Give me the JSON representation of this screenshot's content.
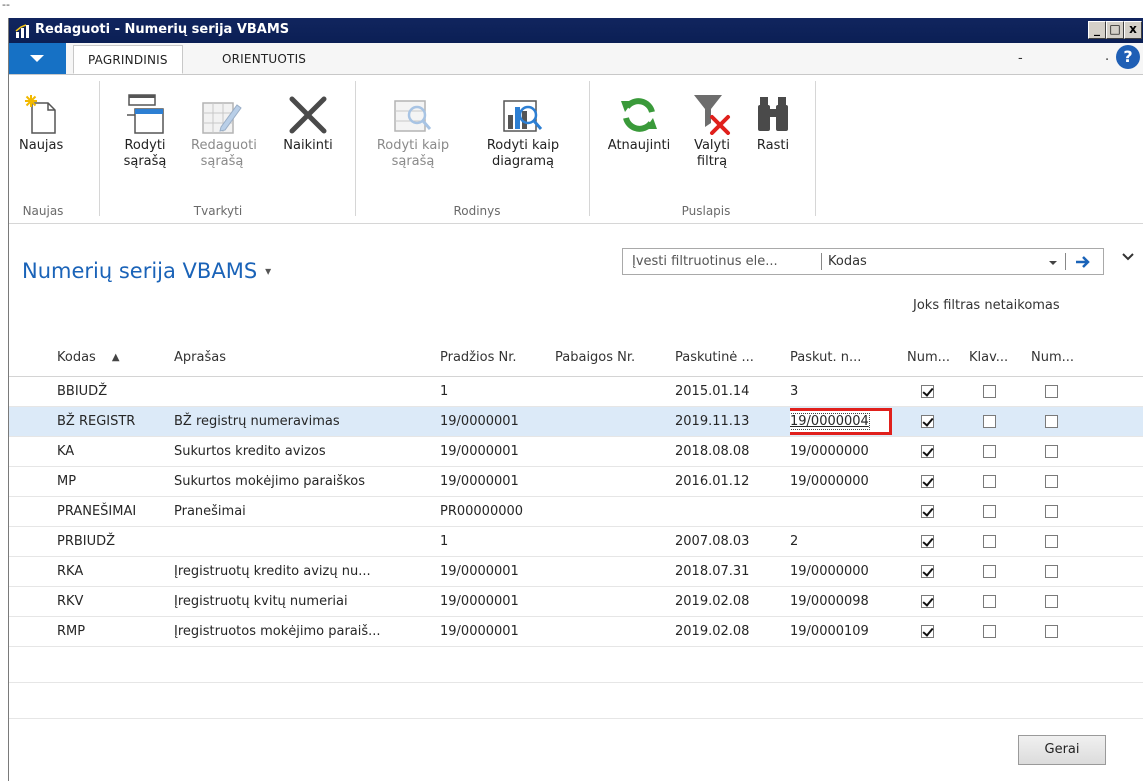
{
  "window": {
    "title": "Redaguoti - Numerių serija VBAMS",
    "controls": {
      "minimize": "_",
      "maximize": "□",
      "close": "x"
    }
  },
  "tabs": {
    "items": [
      {
        "label": "PAGRINDINIS"
      },
      {
        "label": "ORIENTUOTIS"
      }
    ],
    "right_minus": "-",
    "right_dot": ".",
    "help": "?"
  },
  "ribbon": {
    "groups": [
      {
        "label": "Naujas",
        "buttons": [
          {
            "label_line1": "Naujas",
            "label_line2": "",
            "icon": "new-document-icon"
          }
        ]
      },
      {
        "label": "Tvarkyti",
        "buttons": [
          {
            "label_line1": "Rodyti",
            "label_line2": "sąrašą",
            "icon": "show-list-icon"
          },
          {
            "label_line1": "Redaguoti",
            "label_line2": "sąrašą",
            "icon": "edit-list-icon",
            "disabled": true
          },
          {
            "label_line1": "Naikinti",
            "label_line2": "",
            "icon": "delete-icon"
          }
        ]
      },
      {
        "label": "Rodinys",
        "buttons": [
          {
            "label_line1": "Rodyti kaip",
            "label_line2": "sąrašą",
            "icon": "view-list-icon",
            "disabled": true
          },
          {
            "label_line1": "Rodyti kaip",
            "label_line2": "diagramą",
            "icon": "view-chart-icon"
          }
        ]
      },
      {
        "label": "Puslapis",
        "buttons": [
          {
            "label_line1": "Atnaujinti",
            "label_line2": "",
            "icon": "refresh-icon"
          },
          {
            "label_line1": "Valyti",
            "label_line2": "filtrą",
            "icon": "clear-filter-icon"
          },
          {
            "label_line1": "Rasti",
            "label_line2": "",
            "icon": "find-icon"
          }
        ]
      }
    ]
  },
  "page": {
    "title": "Numerių serija VBAMS",
    "title_caret": "▾",
    "filter": {
      "placeholder": "Įvesti filtruotinus ele...",
      "field": "Kodas"
    },
    "no_filter": "Joks filtras netaikomas"
  },
  "grid": {
    "columns": [
      "Kodas",
      "Aprašas",
      "Pradžios Nr.",
      "Pabaigos Nr.",
      "Paskutinė ...",
      "Paskut. n...",
      "Num...",
      "Klav...",
      "Num..."
    ],
    "sort_indicator": "▲",
    "rows": [
      {
        "kodas": "BBIUDŽ",
        "aprasas": "",
        "pradzios": "1",
        "pabaigos": "",
        "paskutine": "2015.01.14",
        "paskut_n": "3",
        "c1": true,
        "c2": false,
        "c3": false
      },
      {
        "kodas": "BŽ REGISTR",
        "aprasas": "BŽ registrų numeravimas",
        "pradzios": "19/0000001",
        "pabaigos": "",
        "paskutine": "2019.11.13",
        "paskut_n": "19/0000004",
        "c1": true,
        "c2": false,
        "c3": false,
        "selected": true
      },
      {
        "kodas": "KA",
        "aprasas": "Sukurtos kredito avizos",
        "pradzios": "19/0000001",
        "pabaigos": "",
        "paskutine": "2018.08.08",
        "paskut_n": "19/0000000",
        "c1": true,
        "c2": false,
        "c3": false
      },
      {
        "kodas": "MP",
        "aprasas": "Sukurtos mokėjimo paraiškos",
        "pradzios": "19/0000001",
        "pabaigos": "",
        "paskutine": "2016.01.12",
        "paskut_n": "19/0000000",
        "c1": true,
        "c2": false,
        "c3": false
      },
      {
        "kodas": "PRANEŠIMAI",
        "aprasas": "Pranešimai",
        "pradzios": "PR00000000",
        "pabaigos": "",
        "paskutine": "",
        "paskut_n": "",
        "c1": true,
        "c2": false,
        "c3": false
      },
      {
        "kodas": "PRBIUDŽ",
        "aprasas": "",
        "pradzios": "1",
        "pabaigos": "",
        "paskutine": "2007.08.03",
        "paskut_n": "2",
        "c1": true,
        "c2": false,
        "c3": false
      },
      {
        "kodas": "RKA",
        "aprasas": "Įregistruotų kredito avizų nu...",
        "pradzios": "19/0000001",
        "pabaigos": "",
        "paskutine": "2018.07.31",
        "paskut_n": "19/0000000",
        "c1": true,
        "c2": false,
        "c3": false
      },
      {
        "kodas": "RKV",
        "aprasas": "Įregistruotų kvitų numeriai",
        "pradzios": "19/0000001",
        "pabaigos": "",
        "paskutine": "2019.02.08",
        "paskut_n": "19/0000098",
        "c1": true,
        "c2": false,
        "c3": false
      },
      {
        "kodas": "RMP",
        "aprasas": "Įregistruotos mokėjimo paraiš...",
        "pradzios": "19/0000001",
        "pabaigos": "",
        "paskutine": "2019.02.08",
        "paskut_n": "19/0000109",
        "c1": true,
        "c2": false,
        "c3": false
      }
    ]
  },
  "footer": {
    "ok_label": "Gerai"
  },
  "colors": {
    "titlebar": "#0b1f55",
    "accent": "#1671c5",
    "title_blue": "#1a63b8",
    "selected_row": "#dceaf8",
    "highlight": "#e0201c"
  }
}
